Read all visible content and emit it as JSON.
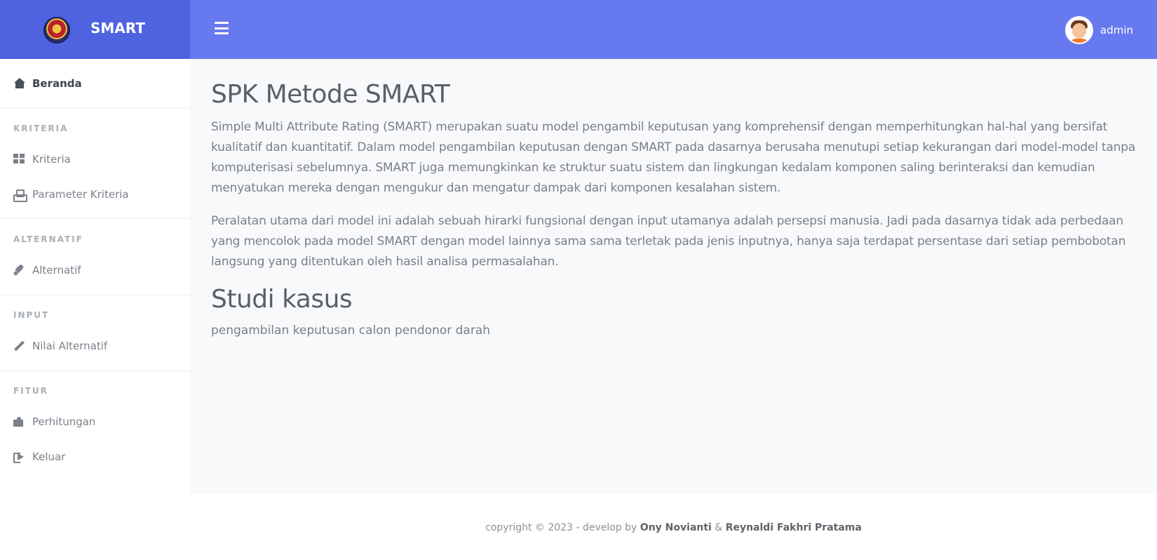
{
  "brand": {
    "title": "SMART",
    "logo_icon": "university-seal-icon"
  },
  "topbar": {
    "menu_icon": "hamburger-icon",
    "user_name": "admin",
    "avatar_icon": "user-avatar-icon"
  },
  "sidebar": {
    "home": {
      "label": "Beranda",
      "icon": "home-icon"
    },
    "sections": [
      {
        "label": "KRITERIA",
        "items": [
          {
            "label": "Kriteria",
            "icon": "grid-icon"
          },
          {
            "label": "Parameter Kriteria",
            "icon": "cubes-icon"
          }
        ]
      },
      {
        "label": "ALTERNATIF",
        "items": [
          {
            "label": "Alternatif",
            "icon": "rocket-icon"
          }
        ]
      },
      {
        "label": "INPUT",
        "items": [
          {
            "label": "Nilai Alternatif",
            "icon": "pencil-icon"
          }
        ]
      },
      {
        "label": "FITUR",
        "items": [
          {
            "label": "Perhitungan",
            "icon": "puzzle-icon"
          },
          {
            "label": "Keluar",
            "icon": "sign-out-icon"
          }
        ]
      }
    ]
  },
  "main": {
    "title": "SPK Metode SMART",
    "paragraph1": "Simple Multi Attribute Rating (SMART) merupakan suatu model pengambil keputusan yang komprehensif dengan memperhitungkan hal-hal yang bersifat kualitatif dan kuantitatif. Dalam model pengambilan keputusan dengan SMART pada dasarnya berusaha menutupi setiap kekurangan dari model-model tanpa komputerisasi sebelumnya. SMART juga memungkinkan ke struktur suatu sistem dan lingkungan kedalam komponen saling berinteraksi dan kemudian menyatukan mereka dengan mengukur dan mengatur dampak dari komponen kesalahan sistem.",
    "paragraph2": "Peralatan utama dari model ini adalah sebuah hirarki fungsional dengan input utamanya adalah persepsi manusia. Jadi pada dasarnya tidak ada perbedaan yang mencolok pada model SMART dengan model lainnya sama sama terletak pada jenis inputnya, hanya saja terdapat persentase dari setiap pembobotan langsung yang ditentukan oleh hasil analisa permasalahan.",
    "subtitle": "Studi kasus",
    "case_text": "pengambilan keputusan calon pendonor darah"
  },
  "footer": {
    "prefix": "copyright © 2023 - develop by",
    "author1": "Ony Novianti",
    "separator": "&",
    "author2": "Reynaldi Fakhri Pratama"
  }
}
